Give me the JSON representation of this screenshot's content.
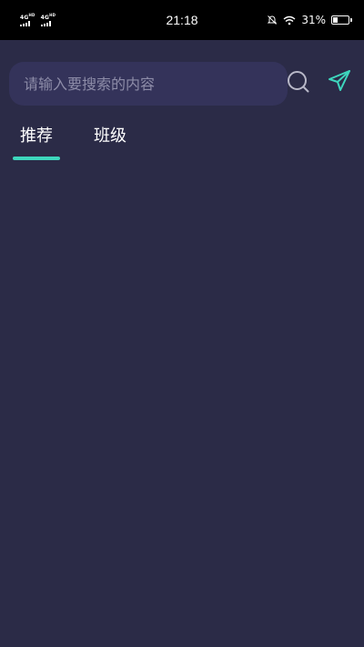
{
  "status_bar": {
    "signal_1": "4G",
    "signal_1_sup": "HD",
    "signal_2": "4G",
    "signal_2_sup": "HD",
    "time": "21:18",
    "battery": "31%",
    "battery_level": 0.31
  },
  "search": {
    "placeholder": "请输入要搜索的内容",
    "value": ""
  },
  "tabs": [
    {
      "label": "推荐",
      "active": true
    },
    {
      "label": "班级",
      "active": false
    }
  ],
  "colors": {
    "background": "#2b2b47",
    "search_box": "#34335a",
    "accent": "#3ed6bd"
  }
}
